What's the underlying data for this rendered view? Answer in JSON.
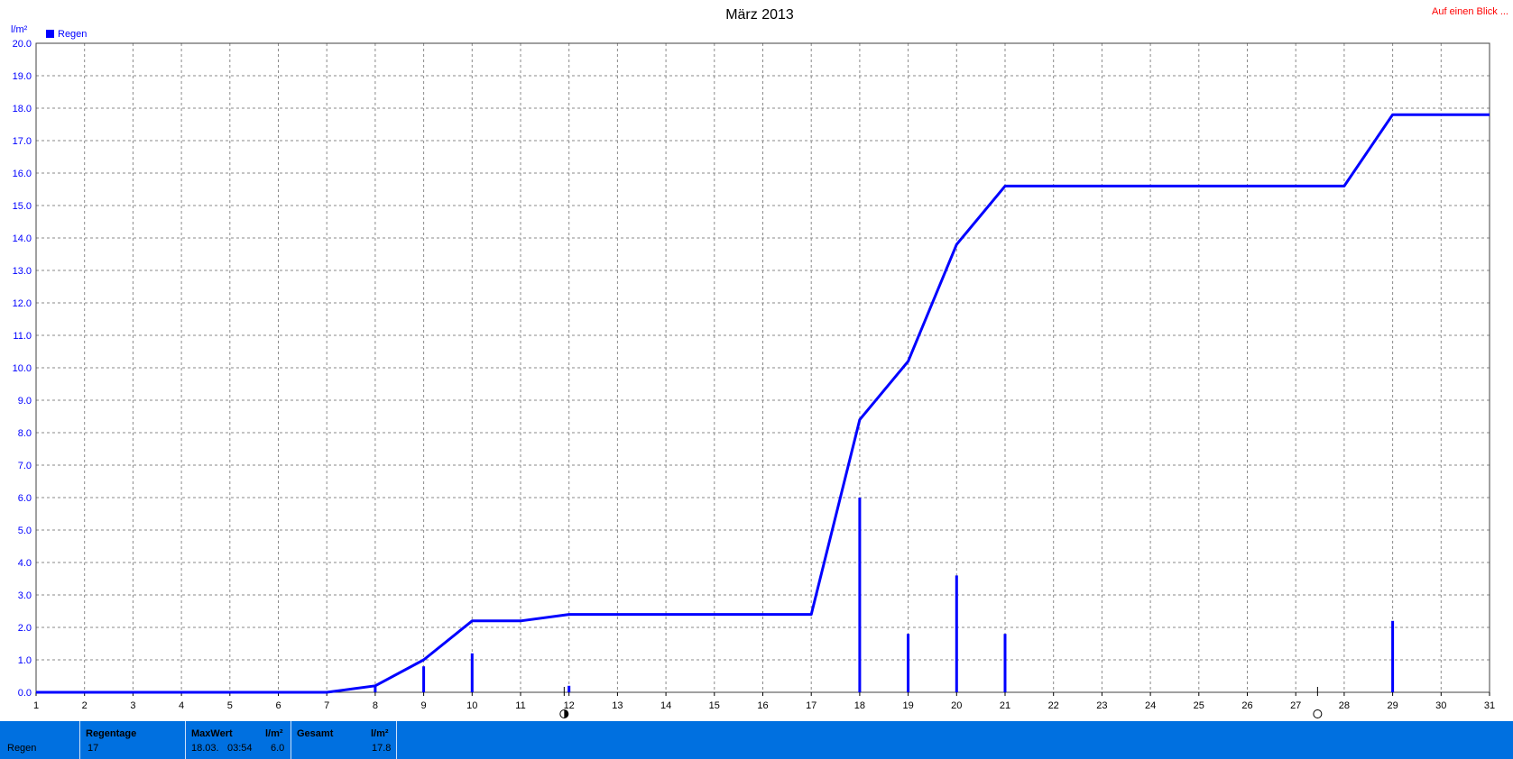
{
  "chart_data": {
    "type": "bar+line",
    "title": "März 2013",
    "ylabel": "l/m²",
    "corner_link": "Auf einen Blick ...",
    "legend": {
      "label": "Regen",
      "color": "#0000ff",
      "placement": "top-left"
    },
    "ylim": [
      0,
      20
    ],
    "yticks": [
      "0.0",
      "1.0",
      "2.0",
      "3.0",
      "4.0",
      "5.0",
      "6.0",
      "7.0",
      "8.0",
      "9.0",
      "10.0",
      "11.0",
      "12.0",
      "13.0",
      "14.0",
      "15.0",
      "16.0",
      "17.0",
      "18.0",
      "19.0",
      "20.0"
    ],
    "xlim": [
      1,
      31
    ],
    "xticks": [
      "1",
      "2",
      "3",
      "4",
      "5",
      "6",
      "7",
      "8",
      "9",
      "10",
      "11",
      "12",
      "13",
      "14",
      "15",
      "16",
      "17",
      "18",
      "19",
      "20",
      "21",
      "22",
      "23",
      "24",
      "25",
      "26",
      "27",
      "28",
      "29",
      "30",
      "31"
    ],
    "grid": true,
    "series": [
      {
        "type": "bar",
        "color": "#0000ff",
        "x": [
          8,
          9,
          10,
          12,
          18,
          19,
          20,
          21,
          29
        ],
        "values": [
          0.2,
          0.8,
          1.2,
          0.2,
          6.0,
          1.8,
          3.6,
          1.8,
          2.2
        ]
      },
      {
        "type": "line",
        "color": "#0000ff",
        "x": [
          1,
          7,
          8,
          9,
          10,
          11,
          12,
          17,
          18,
          19,
          20,
          21,
          28,
          29,
          31
        ],
        "values": [
          0.0,
          0.0,
          0.2,
          1.0,
          2.2,
          2.2,
          2.4,
          2.4,
          8.4,
          10.2,
          13.8,
          15.6,
          15.6,
          17.8,
          17.8
        ]
      }
    ],
    "moon_phases": [
      {
        "x": 11.9,
        "icon": "half-moon-icon"
      },
      {
        "x": 27.45,
        "icon": "full-moon-icon"
      }
    ]
  },
  "stats": {
    "row_label": "Regen",
    "regentage_label": "Regentage",
    "regentage_value": "17",
    "maxwert_label": "MaxWert",
    "maxwert_unit": "l/m²",
    "maxwert_date": "18.03.",
    "maxwert_time": "03:54",
    "maxwert_value": "6.0",
    "gesamt_label": "Gesamt",
    "gesamt_unit": "l/m²",
    "gesamt_value": "17.8"
  },
  "colors": {
    "series": "#0000ff",
    "link": "#ff0000",
    "stats_bar": "#0070e0"
  }
}
